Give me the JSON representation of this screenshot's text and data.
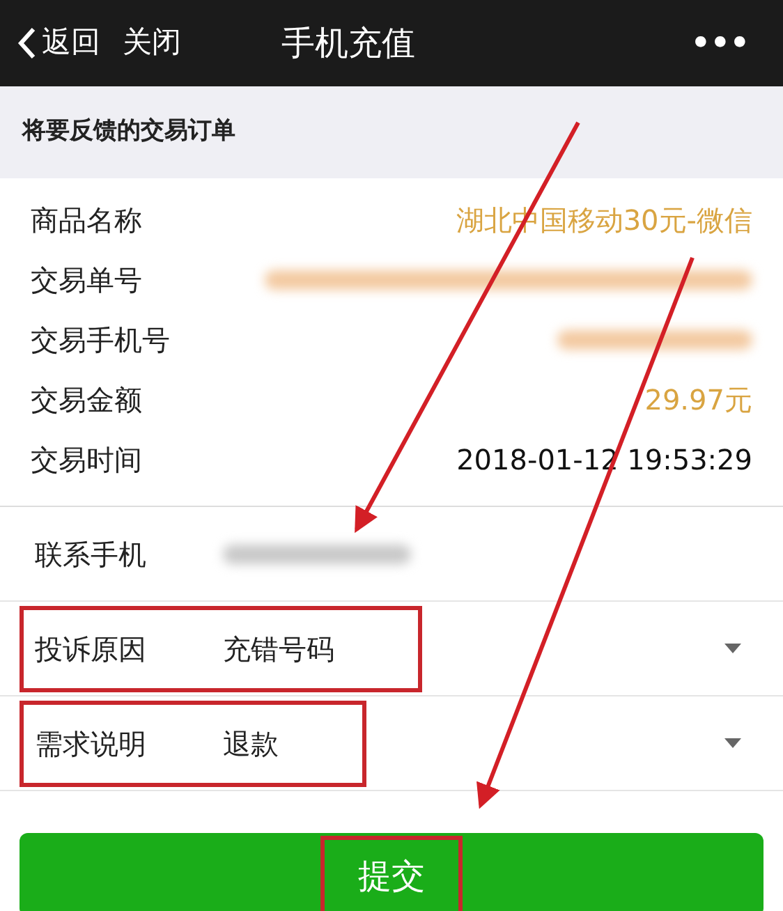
{
  "nav": {
    "back": "返回",
    "close": "关闭",
    "title": "手机充值",
    "more": "•••"
  },
  "section_title": "将要反馈的交易订单",
  "order_rows": [
    {
      "label": "商品名称",
      "kind": "text",
      "value": "湖北中国移动30元-微信",
      "accent": true
    },
    {
      "label": "交易单号",
      "kind": "redacted",
      "accent": true
    },
    {
      "label": "交易手机号",
      "kind": "redacted",
      "accent": true
    },
    {
      "label": "交易金额",
      "kind": "text",
      "value": "29.97元",
      "accent": true
    },
    {
      "label": "交易时间",
      "kind": "text",
      "value": "2018-01-12 19:53:29",
      "accent": false
    }
  ],
  "form_rows": [
    {
      "label": "联系手机",
      "kind": "redacted",
      "dropdown": false,
      "highlighted": false
    },
    {
      "label": "投诉原因",
      "kind": "text",
      "value": "充错号码",
      "dropdown": true,
      "highlighted": true
    },
    {
      "label": "需求说明",
      "kind": "text",
      "value": "退款",
      "dropdown": true,
      "highlighted": true
    }
  ],
  "submit": {
    "label": "提交",
    "highlighted": true
  }
}
